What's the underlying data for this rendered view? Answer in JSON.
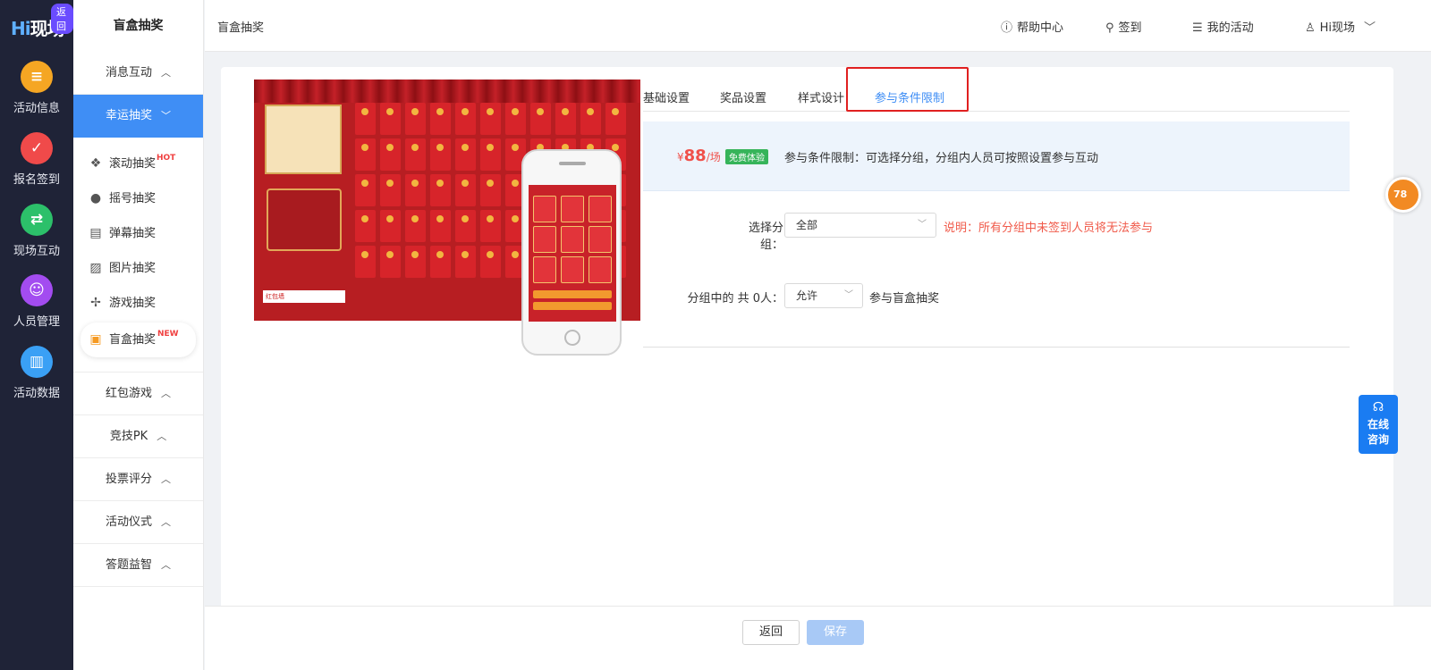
{
  "rail": {
    "logo": "现场",
    "logo_hi": "Hi",
    "badge": "返回",
    "items": [
      {
        "label": "活动信息",
        "icon": "document-icon",
        "color": "#f5a623"
      },
      {
        "label": "报名签到",
        "icon": "calendar-check-icon",
        "color": "#f04a4a"
      },
      {
        "label": "现场互动",
        "icon": "interact-icon",
        "color": "#2cc06a"
      },
      {
        "label": "人员管理",
        "icon": "person-card-icon",
        "color": "#a34cf0"
      },
      {
        "label": "活动数据",
        "icon": "bar-chart-icon",
        "color": "#3aa0f5"
      }
    ]
  },
  "sidebar": {
    "title": "盲盒抽奖",
    "group_message": "消息互动",
    "group_lucky": "幸运抽奖",
    "sub_items": [
      {
        "label": "滚动抽奖",
        "tag": "HOT",
        "icon": "gift-icon"
      },
      {
        "label": "摇号抽奖",
        "tag": "",
        "icon": "person-icon"
      },
      {
        "label": "弹幕抽奖",
        "tag": "",
        "icon": "barrage-icon"
      },
      {
        "label": "图片抽奖",
        "tag": "",
        "icon": "image-icon"
      },
      {
        "label": "游戏抽奖",
        "tag": "",
        "icon": "wheel-icon"
      },
      {
        "label": "盲盒抽奖",
        "tag": "NEW",
        "icon": "blind-box-icon"
      }
    ],
    "groups_after": [
      "红包游戏",
      "竞技PK",
      "投票评分",
      "活动仪式",
      "答题益智"
    ]
  },
  "header": {
    "breadcrumb": "盲盒抽奖",
    "help": "帮助中心",
    "signin": "签到",
    "my_activity": "我的活动",
    "user": "Hi现场"
  },
  "preview": {
    "select_label": "红包墙"
  },
  "tabs": [
    "基础设置",
    "奖品设置",
    "样式设计",
    "参与条件限制"
  ],
  "active_tab": "参与条件限制",
  "info": {
    "currency": "¥",
    "price": "88",
    "unit": "/场",
    "free_tag": "免费体验",
    "text": "参与条件限制：可选择分组，分组内人员可按照设置参与互动"
  },
  "form": {
    "group_label": "选择分组：",
    "group_value": "全部",
    "group_hint": "说明：所有分组中未签到人员将无法参与",
    "member_label": "分组中的 共 0人：",
    "member_value": "允许",
    "member_suffix": "参与盲盒抽奖"
  },
  "footer": {
    "back": "返回",
    "save": "保存"
  },
  "float": {
    "consult_line1": "在线",
    "consult_line2": "咨询",
    "circle": "78"
  },
  "colors": {
    "primary": "#3f8ef5",
    "rail_bg": "#1f2337",
    "danger": "#f05a4a",
    "highlight_box": "#e02020"
  }
}
